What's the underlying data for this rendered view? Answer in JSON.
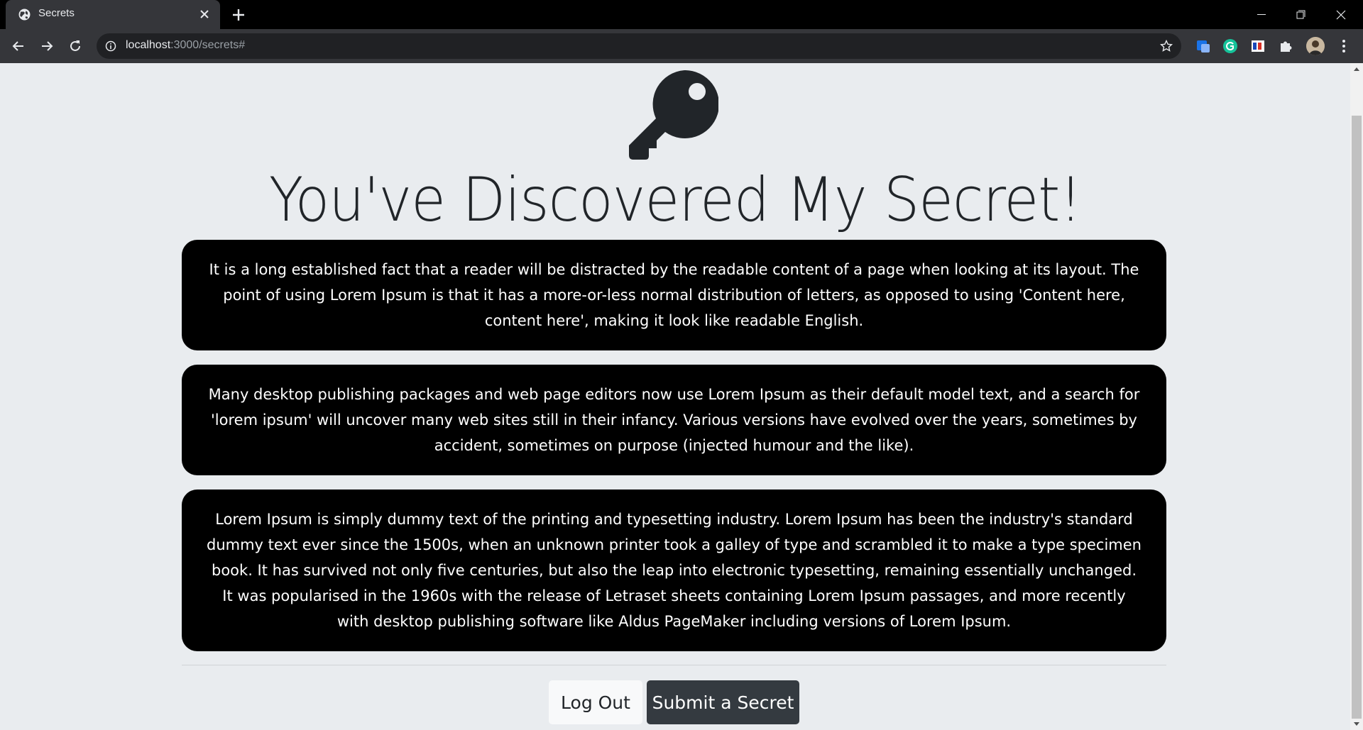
{
  "browser": {
    "tab_title": "Secrets",
    "url_host": "localhost",
    "url_path": ":3000/secrets#"
  },
  "page": {
    "title": "You've Discovered My Secret!",
    "secrets": [
      "It is a long established fact that a reader will be distracted by the readable content of a page when looking at its layout. The point of using Lorem Ipsum is that it has a more-or-less normal distribution of letters, as opposed to using 'Content here, content here', making it look like readable English.",
      "Many desktop publishing packages and web page editors now use Lorem Ipsum as their default model text, and a search for 'lorem ipsum' will uncover many web sites still in their infancy. Various versions have evolved over the years, sometimes by accident, sometimes on purpose (injected humour and the like).",
      "Lorem Ipsum is simply dummy text of the printing and typesetting industry. Lorem Ipsum has been the industry's standard dummy text ever since the 1500s, when an unknown printer took a galley of type and scrambled it to make a type specimen book. It has survived not only five centuries, but also the leap into electronic typesetting, remaining essentially unchanged. It was popularised in the 1960s with the release of Letraset sheets containing Lorem Ipsum passages, and more recently with desktop publishing software like Aldus PageMaker including versions of Lorem Ipsum."
    ],
    "logout_label": "Log Out",
    "submit_label": "Submit a Secret"
  },
  "icons": {
    "key": "key-icon",
    "favicon": "globe-icon"
  },
  "colors": {
    "page_bg": "#e9ecef",
    "card_bg": "#000000",
    "submit_bg": "#343a40",
    "logout_bg": "#f8f9fa"
  }
}
